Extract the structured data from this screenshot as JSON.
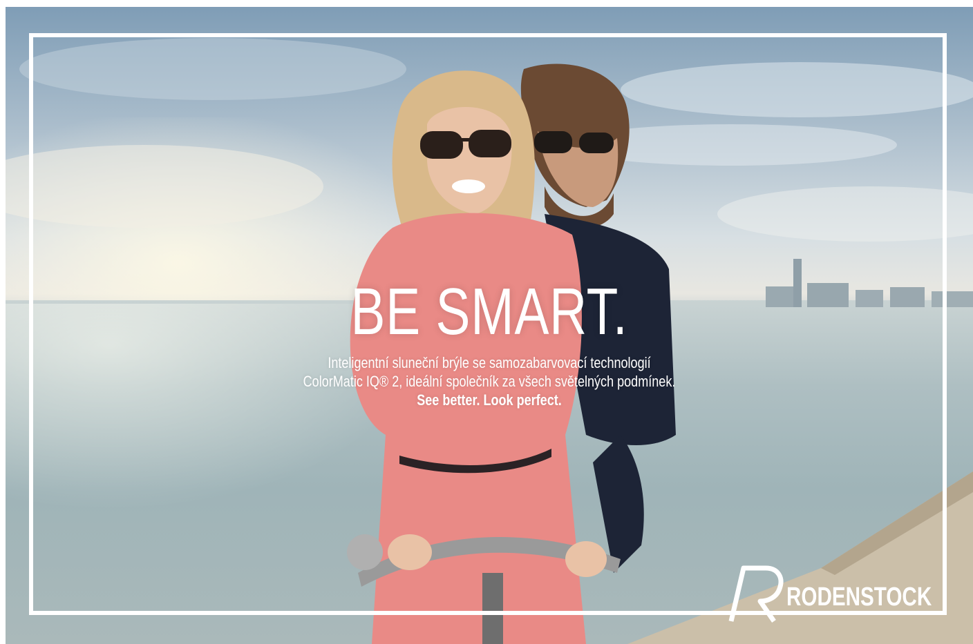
{
  "headline": "BE SMART.",
  "subtext": {
    "line1": "Inteligentní sluneční brýle se samozabarvovací technologií",
    "line2": "ColorMatic IQ® 2, ideální společník za všech světelných podmínek.",
    "tagline": "See better. Look perfect."
  },
  "logo": {
    "text": "RODENSTOCK",
    "icon": "rodenstock-r-mark"
  },
  "colors": {
    "text": "#ffffff",
    "frame": "#ffffff"
  }
}
